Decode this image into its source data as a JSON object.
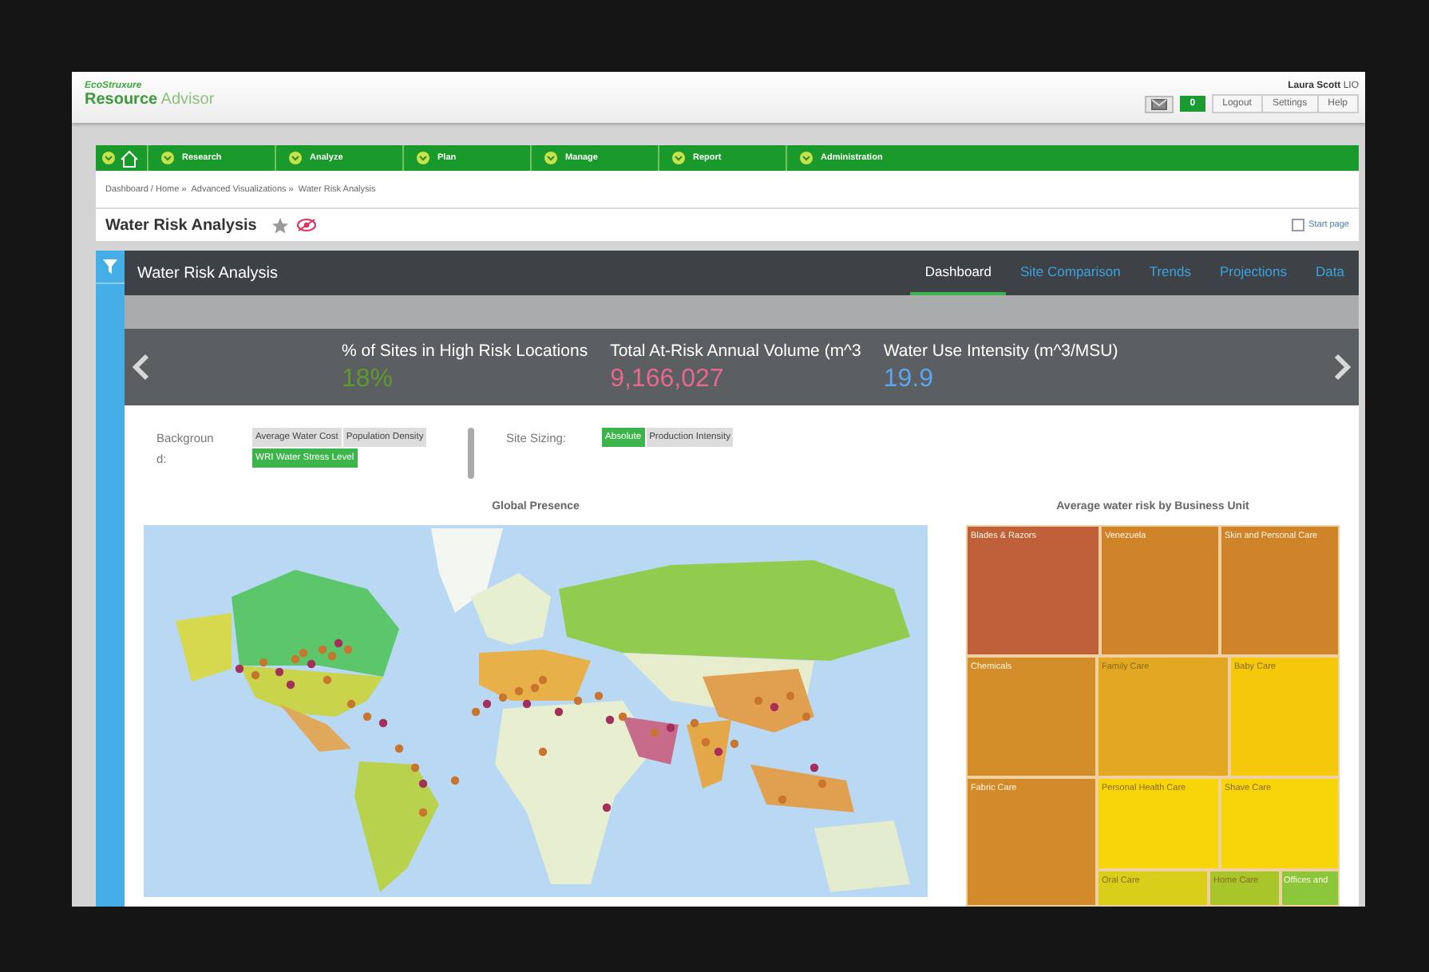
{
  "app": {
    "brand": "EcoStruxure",
    "product_bold": "Resource",
    "product_light": "Advisor"
  },
  "user": {
    "name": "Laura Scott",
    "org": "LIO"
  },
  "header": {
    "notifications": "0",
    "links": [
      "Logout",
      "Settings",
      "Help"
    ]
  },
  "nav": [
    {
      "label": "Research"
    },
    {
      "label": "Analyze"
    },
    {
      "label": "Plan"
    },
    {
      "label": "Manage"
    },
    {
      "label": "Report"
    },
    {
      "label": "Administration"
    }
  ],
  "breadcrumb": [
    "Dashboard / Home »",
    "Advanced Visualizations »",
    "Water Risk Analysis"
  ],
  "page": {
    "title": "Water Risk Analysis",
    "start_page": {
      "label": "Start page",
      "checked": false
    }
  },
  "dashboard": {
    "title": "Water Risk Analysis",
    "tabs": [
      {
        "label": "Dashboard",
        "selected": true
      },
      {
        "label": "Site Comparison",
        "selected": false
      },
      {
        "label": "Trends",
        "selected": false
      },
      {
        "label": "Projections",
        "selected": false
      },
      {
        "label": "Data",
        "selected": false
      }
    ],
    "kpis": [
      {
        "label": "% of Sites in High Risk Locations",
        "value": "18%",
        "color": "#5e9a2c"
      },
      {
        "label": "Total At-Risk Annual Volume (m^3",
        "value": "9,166,027",
        "color": "#e8678a"
      },
      {
        "label": "Water Use Intensity (m^3/MSU)",
        "value": "19.9",
        "color": "#5aa6f0"
      }
    ],
    "filters": [
      {
        "label": "Background:",
        "options": [
          {
            "label": "Average Water Cost",
            "selected": false
          },
          {
            "label": "Population Density",
            "selected": false
          },
          {
            "label": "WRI Water Stress Level",
            "selected": true
          }
        ]
      },
      {
        "label": "Site Sizing:",
        "options": [
          {
            "label": "Absolute",
            "selected": true
          },
          {
            "label": "Production Intensity",
            "selected": false
          }
        ]
      }
    ],
    "map": {
      "title": "Global Presence"
    },
    "treemap": {
      "title": "Average water risk by Business Unit",
      "tiles": [
        {
          "label": "Blades & Razors",
          "color": "#c0603a"
        },
        {
          "label": "Venezuela",
          "color": "#d0842a"
        },
        {
          "label": "Skin and Personal Care",
          "color": "#d0842a"
        },
        {
          "label": "Chemicals",
          "color": "#d38d28"
        },
        {
          "label": "Fabric Care",
          "color": "#d38a2a"
        },
        {
          "label": "Family Care",
          "color": "#e2a822"
        },
        {
          "label": "Baby Care",
          "color": "#f5c80c"
        },
        {
          "label": "Personal Health Care",
          "color": "#f8d508"
        },
        {
          "label": "Shave Care",
          "color": "#f8d508"
        },
        {
          "label": "Oral Care",
          "color": "#d9cf1a"
        },
        {
          "label": "Home Care",
          "color": "#a8c62a"
        },
        {
          "label": "Offices and",
          "color": "#8cc63a"
        }
      ]
    }
  }
}
